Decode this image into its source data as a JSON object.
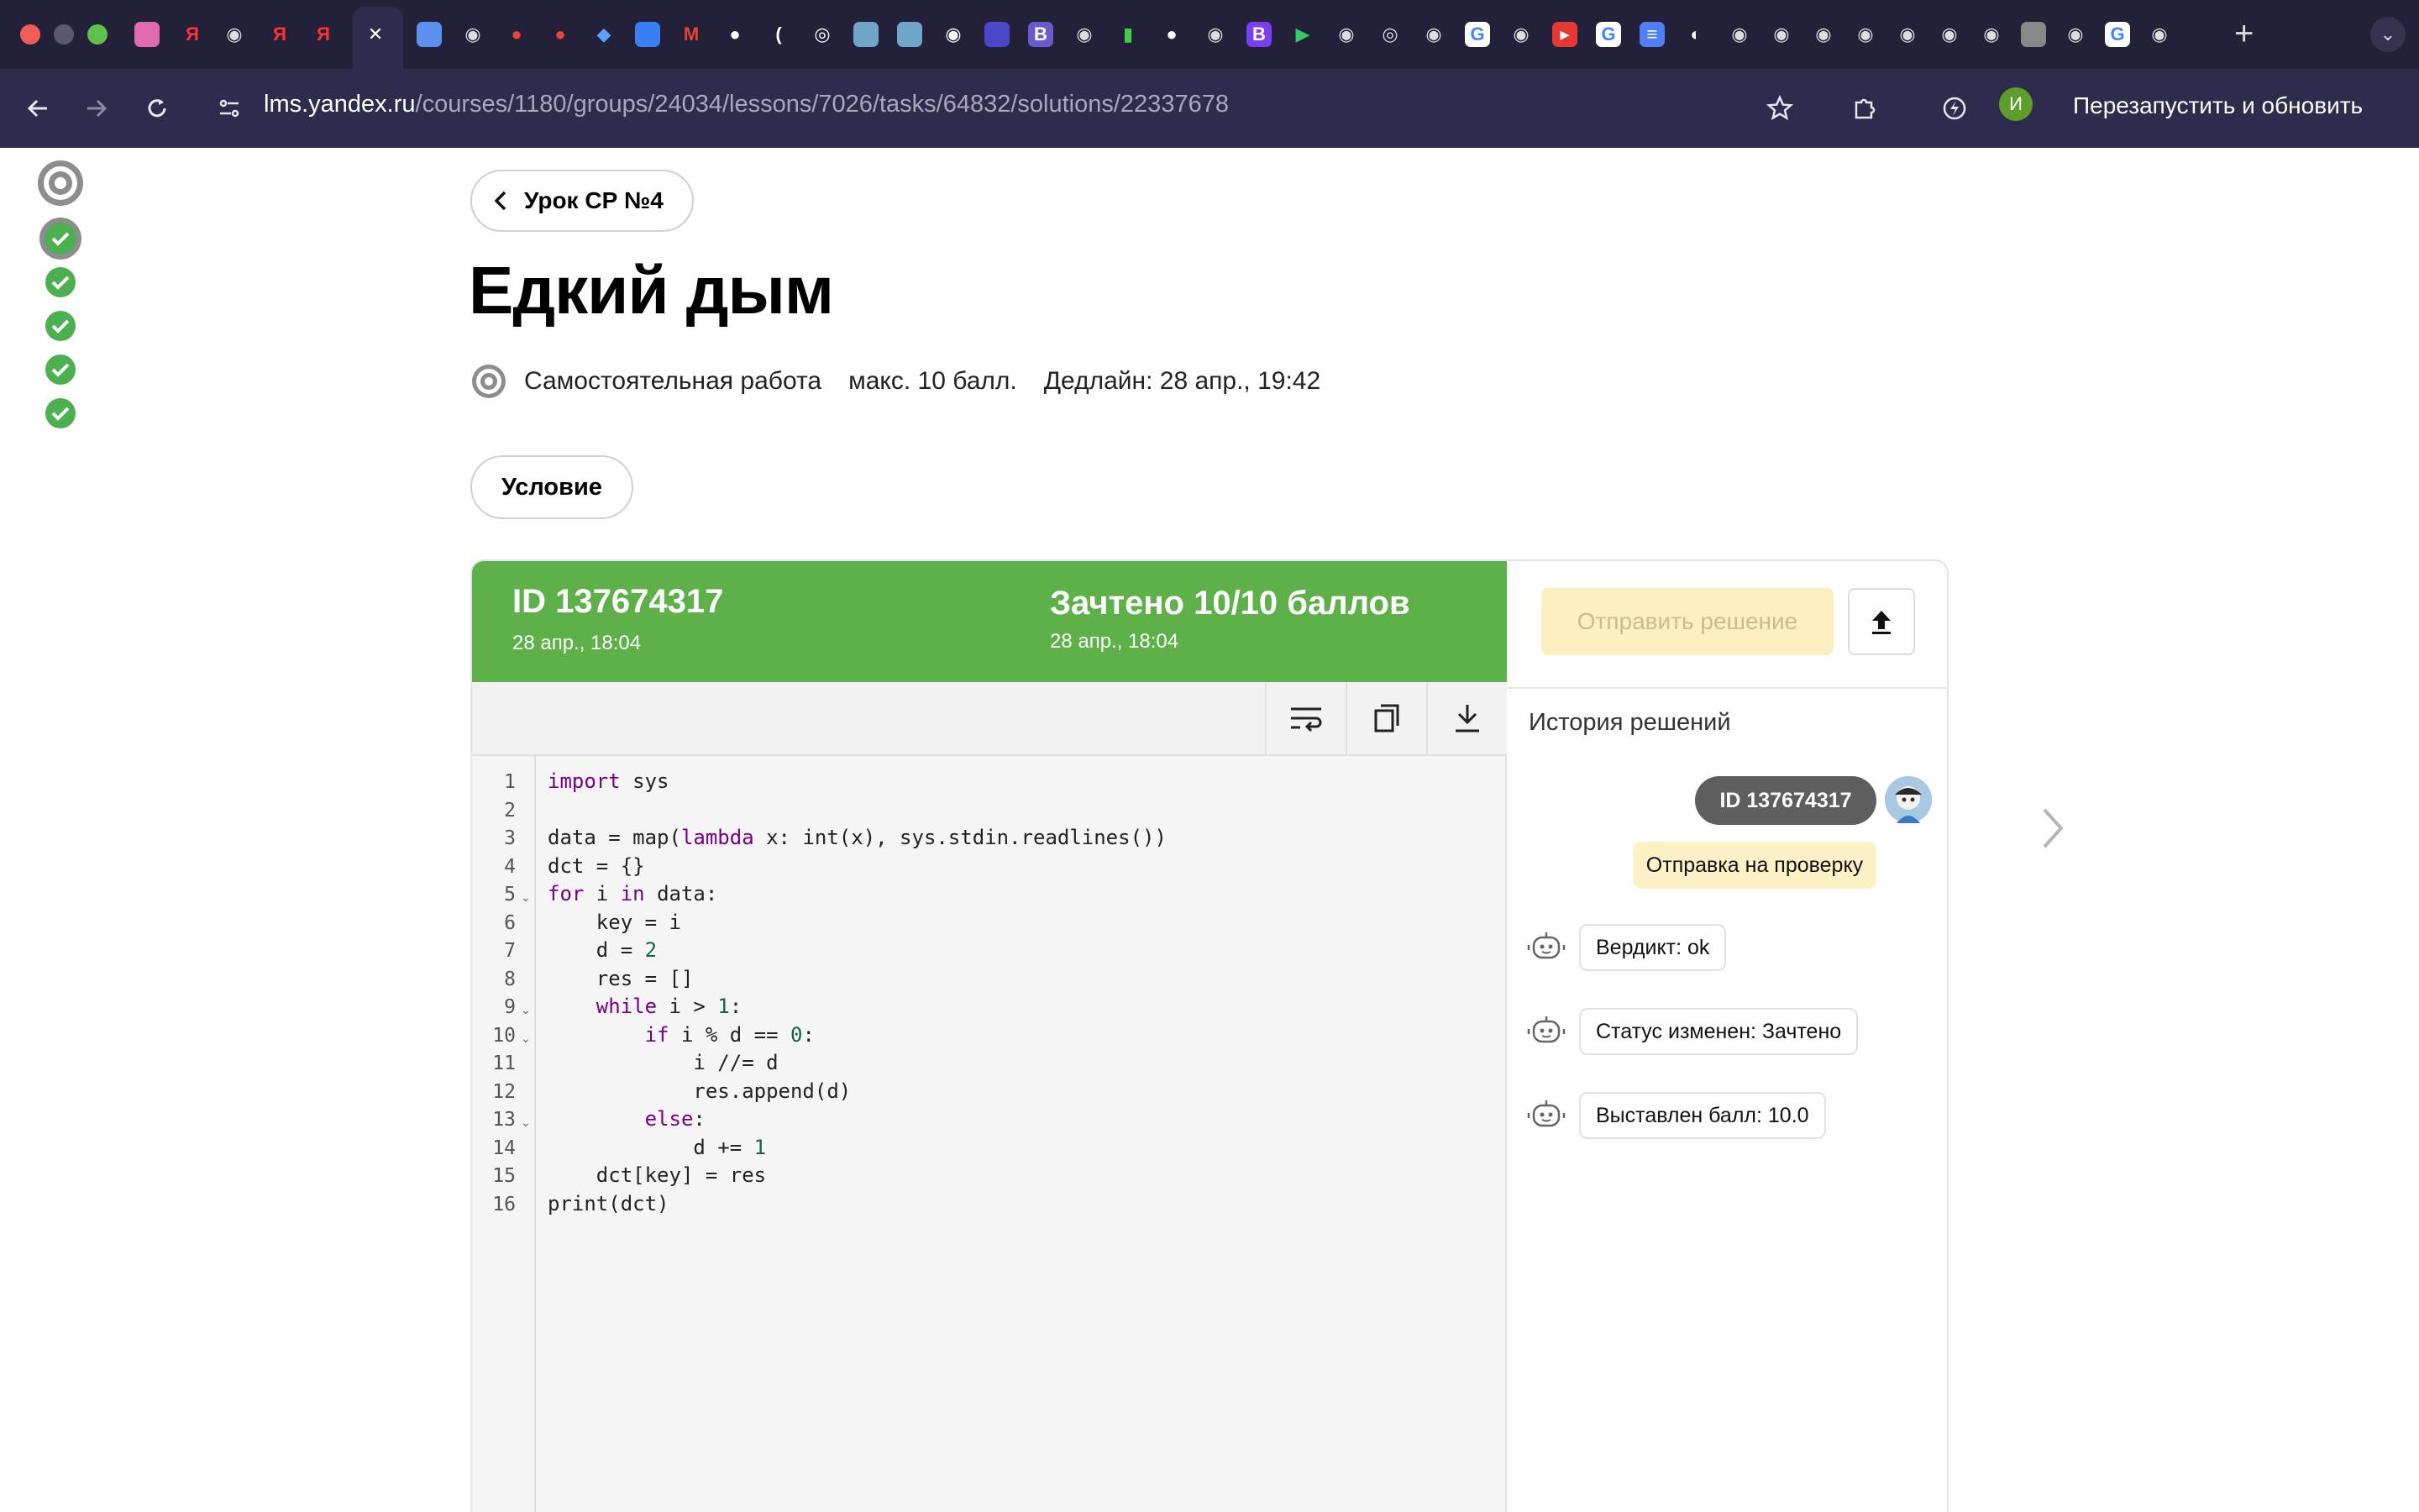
{
  "browser": {
    "url_host": "lms.yandex.ru",
    "url_path": "/courses/1180/groups/24034/lessons/7026/tasks/64832/solutions/22337678",
    "profile_initial": "И",
    "relaunch_label": "Перезапустить и обновить"
  },
  "page": {
    "back_label": "Урок СР №4",
    "title": "Едкий дым",
    "task_type": "Самостоятельная работа",
    "max_score": "макс. 10 балл.",
    "deadline": "Дедлайн: 28 апр., 19:42",
    "condition_label": "Условие"
  },
  "solution": {
    "id_label": "ID 137674317",
    "submitted_date": "28 апр., 18:04",
    "status_label": "Зачтено 10/10 баллов",
    "status_date": "28 апр., 18:04",
    "status_color": "#5db148",
    "code_lines": [
      "import sys",
      "",
      "data = map(lambda x: int(x), sys.stdin.readlines())",
      "dct = {}",
      "for i in data:",
      "    key = i",
      "    d = 2",
      "    res = []",
      "    while i > 1:",
      "        if i % d == 0:",
      "            i //= d",
      "            res.append(d)",
      "        else:",
      "            d += 1",
      "    dct[key] = res",
      "print(dct)"
    ],
    "line_numbers": [
      "1",
      "2",
      "3",
      "4",
      "5",
      "6",
      "7",
      "8",
      "9",
      "10",
      "11",
      "12",
      "13",
      "14",
      "15",
      "16"
    ],
    "fold_lines": [
      5,
      9,
      10,
      13
    ],
    "toolbar_icons": [
      "wrap-lines-icon",
      "copy-icon",
      "download-icon"
    ]
  },
  "sidebar": {
    "send_label": "Отправить решение",
    "history_title": "История решений",
    "history_id": "ID 137674317",
    "sent_label": "Отправка на проверку",
    "events": [
      {
        "text": "Вердикт: ok"
      },
      {
        "text": "Статус изменен: Зачтено"
      },
      {
        "text": "Выставлен балл: 10.0"
      }
    ]
  },
  "rail": {
    "items": [
      "current-task-icon",
      "task-done-icon",
      "task-done-icon",
      "task-done-icon",
      "task-done-icon",
      "task-done-icon"
    ]
  }
}
